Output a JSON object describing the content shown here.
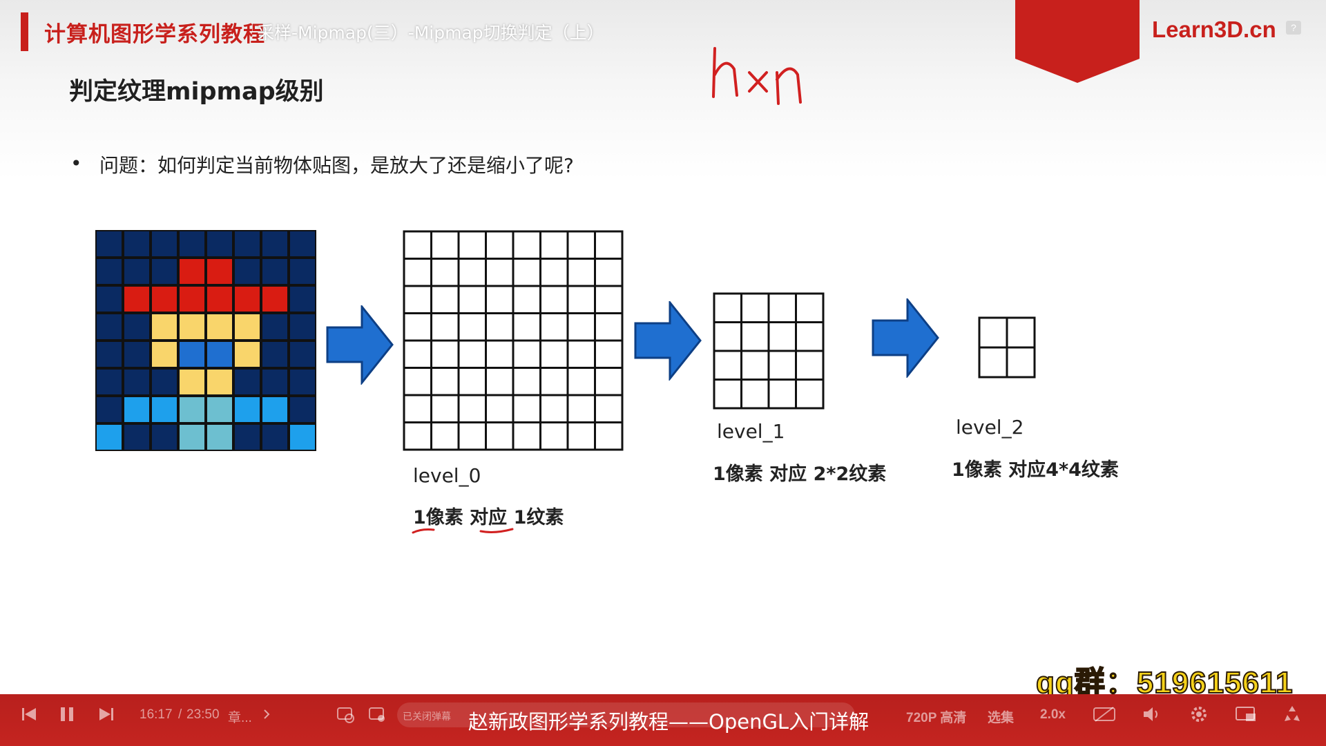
{
  "header": {
    "course_title": "计算机图形学系列教程",
    "video_title": "采样-Mipmap(三）-Mipmap切换判定（上）",
    "logo_text": "Learn3D.cn",
    "help_icon": "?"
  },
  "slide": {
    "heading": "判定纹理mipmap级别",
    "bullet_dot": "•",
    "bullet": "问题：如何判定当前物体贴图，是放大了还是缩小了呢?",
    "handwriting": "n×n",
    "levels": [
      {
        "label": "level_0",
        "desc": "1像素 对应 1纹素"
      },
      {
        "label": "level_1",
        "desc": "1像素 对应 2*2纹素"
      },
      {
        "label": "level_2",
        "desc": "1像素 对应4*4纹素"
      }
    ],
    "texture_colors": {
      "navy": "#0a2a62",
      "red": "#d91c12",
      "yellow": "#f9d56b",
      "blue": "#1f6fd0",
      "cyan": "#1ea0ec",
      "teal": "#6dbfd0"
    }
  },
  "overlay": {
    "qq_group": "qq群：519615611"
  },
  "player": {
    "time_current": "16:17",
    "time_sep": "/",
    "time_total": "23:50",
    "chapter": "章...",
    "danmaku_status": "已关闭弹幕",
    "subtitle": "赵新政图形学系列教程——OpenGL入门详解",
    "quality": "720P 高清",
    "episodes": "选集",
    "speed": "2.0x",
    "accent": "#c42420"
  }
}
